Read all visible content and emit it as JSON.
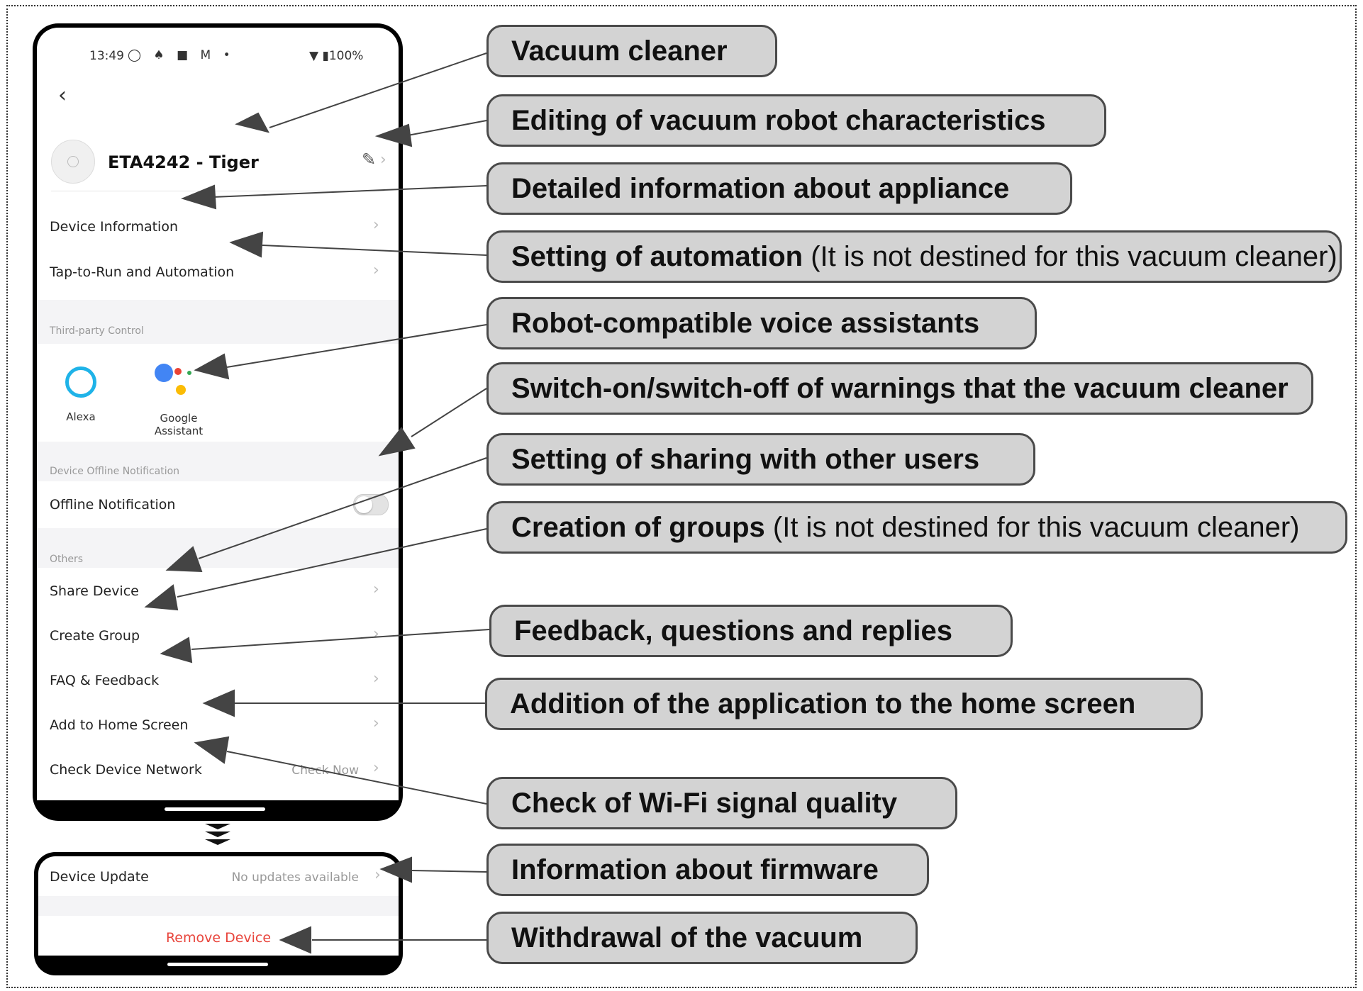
{
  "phone": {
    "status_time": "13:49",
    "status_icons_left": "◯ ♠ ■ M •",
    "status_battery": "▼ ▮100%",
    "device_name": "ETA4242 - Tiger",
    "rows": {
      "device_information": "Device Information",
      "tap_to_run": "Tap-to-Run and Automation",
      "offline_notification": "Offline Notification",
      "share_device": "Share Device",
      "create_group": "Create Group",
      "faq_feedback": "FAQ & Feedback",
      "add_home": "Add to Home Screen",
      "check_network": "Check Device Network",
      "check_now": "Check Now",
      "device_update": "Device Update",
      "no_updates": "No updates available"
    },
    "sections": {
      "third_party": "Third-party Control",
      "offline": "Device Offline Notification",
      "others": "Others"
    },
    "third_party": {
      "alexa": "Alexa",
      "google_line1": "Google",
      "google_line2": "Assistant"
    },
    "offline_toggle_on": false,
    "remove_device": "Remove Device"
  },
  "callouts": {
    "vacuum": {
      "bold": "Vacuum cleaner",
      "normal": ""
    },
    "editing": {
      "bold": "Editing of vacuum robot characteristics",
      "normal": ""
    },
    "detailed": {
      "bold": "Detailed information about appliance",
      "normal": ""
    },
    "automation": {
      "bold": "Setting of automation",
      "normal": " (It is not destined for this vacuum cleaner)"
    },
    "voice": {
      "bold": "Robot-compatible voice assistants",
      "normal": ""
    },
    "warnings": {
      "bold": "Switch-on/switch-off of warnings that the vacuum cleaner",
      "normal": ""
    },
    "sharing": {
      "bold": "Setting of sharing with other users",
      "normal": ""
    },
    "groups": {
      "bold": "Creation of groups",
      "normal": " (It is not destined for this vacuum cleaner)"
    },
    "feedback": {
      "bold": "Feedback, questions and replies",
      "normal": ""
    },
    "homescreen": {
      "bold": "Addition of the application to the home screen",
      "normal": ""
    },
    "wifi": {
      "bold": "Check of Wi-Fi signal quality",
      "normal": ""
    },
    "firmware": {
      "bold": "Information about firmware",
      "normal": ""
    },
    "withdrawal": {
      "bold": "Withdrawal of the vacuum",
      "normal": ""
    }
  },
  "colors": {
    "callout_fill": "#d3d3d3",
    "callout_border": "#4a4a4a",
    "arrow": "#444444",
    "alexa": "#1fb3e8",
    "remove": "#e8453c"
  }
}
